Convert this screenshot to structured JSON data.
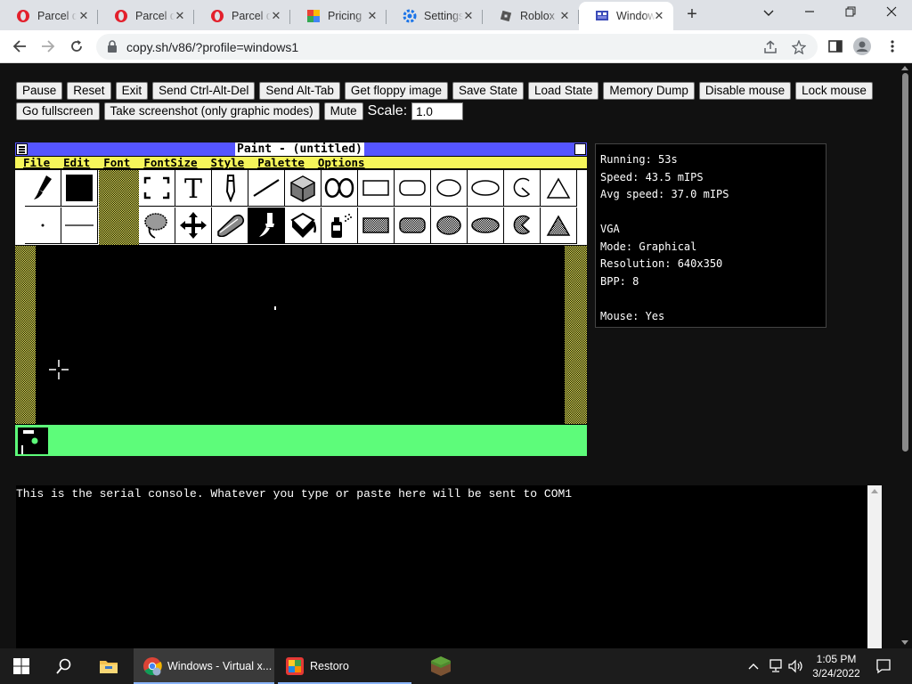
{
  "browser": {
    "tabs": [
      {
        "title": "Parcel d",
        "icon": "opera-icon",
        "active": false
      },
      {
        "title": "Parcel d",
        "icon": "opera-icon",
        "active": false
      },
      {
        "title": "Parcel d",
        "icon": "opera-icon",
        "active": false
      },
      {
        "title": "Pricing",
        "icon": "pricing-icon",
        "active": false
      },
      {
        "title": "Settings",
        "icon": "settings-gear-icon",
        "active": false
      },
      {
        "title": "Roblox",
        "icon": "roblox-icon",
        "active": false
      },
      {
        "title": "Windows",
        "icon": "v86-icon",
        "active": true
      }
    ],
    "url": "copy.sh/v86/?profile=windows1"
  },
  "controls": {
    "row1": [
      "Pause",
      "Reset",
      "Exit",
      "Send Ctrl-Alt-Del",
      "Send Alt-Tab",
      "Get floppy image",
      "Save State",
      "Load State",
      "Memory Dump",
      "Disable mouse",
      "Lock mouse"
    ],
    "row2": [
      "Go fullscreen",
      "Take screenshot (only graphic modes)",
      "Mute"
    ],
    "scale_label": "Scale:",
    "scale_value": "1.0"
  },
  "paint": {
    "title": "Paint - (untitled)",
    "menu": [
      "File",
      "Edit",
      "Font",
      "FontSize",
      "Style",
      "Palette",
      "Options"
    ]
  },
  "status": {
    "lines": [
      "Running: 53s",
      "Speed: 43.5 mIPS",
      "Avg speed: 37.0 mIPS",
      "",
      "VGA",
      "Mode: Graphical",
      "Resolution: 640x350",
      "BPP: 8",
      "",
      "Mouse: Yes"
    ]
  },
  "serial": {
    "text": "This is the serial console. Whatever you type or paste here will be sent to COM1"
  },
  "taskbar": {
    "chrome_label": "Windows - Virtual x...",
    "restoro_label": "Restoro",
    "time": "1:05 PM",
    "date": "3/24/2022"
  },
  "colors": {
    "paint_title": "#5555ff",
    "paint_menu": "#f6f65a",
    "paint_palette": "#5dfc7a"
  }
}
